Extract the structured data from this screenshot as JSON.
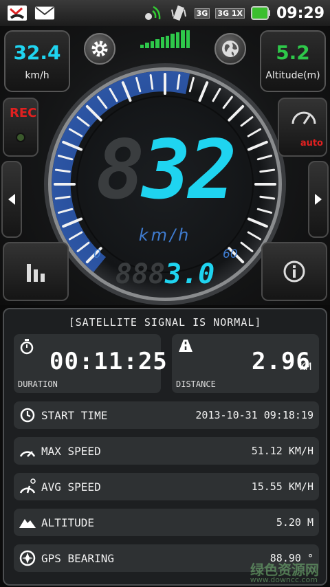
{
  "status_bar": {
    "time": "09:29",
    "badge_3g": "3G",
    "badge_3g1x": "3G 1X"
  },
  "top": {
    "speed_value": "32.4",
    "speed_unit": "km/h",
    "altitude_value": "5.2",
    "altitude_label": "Altitude(m)",
    "rec_label": "REC",
    "auto_label": "auto",
    "big_speed_ghost": "8",
    "big_speed": "32",
    "gauge_unit": "km/h",
    "scale_min": "0",
    "scale_max": "60",
    "odo_ghost": "888",
    "odo_value": "3.0",
    "accent_color": "#1fd4f0",
    "arc_color": "#2e5db8"
  },
  "panel": {
    "satellite_status": "[SATELLITE SIGNAL IS NORMAL]",
    "duration_value": "00:11:25",
    "duration_label": "DURATION",
    "distance_value": "2.96",
    "distance_unit": "KM",
    "distance_label": "DISTANCE",
    "rows": [
      {
        "name": "START TIME",
        "value": "2013-10-31 09:18:19",
        "icon": "clock-icon"
      },
      {
        "name": "MAX SPEED",
        "value": "51.12 KM/H",
        "icon": "speedometer-icon"
      },
      {
        "name": "AVG SPEED",
        "value": "15.55 KM/H",
        "icon": "avg-speed-icon"
      },
      {
        "name": "ALTITUDE",
        "value": "5.20 M",
        "icon": "mountain-icon"
      },
      {
        "name": "GPS BEARING",
        "value": "88.90 °",
        "icon": "compass-icon"
      }
    ]
  },
  "watermark": {
    "text": "绿色资源网",
    "url": "www.downcc.com"
  }
}
